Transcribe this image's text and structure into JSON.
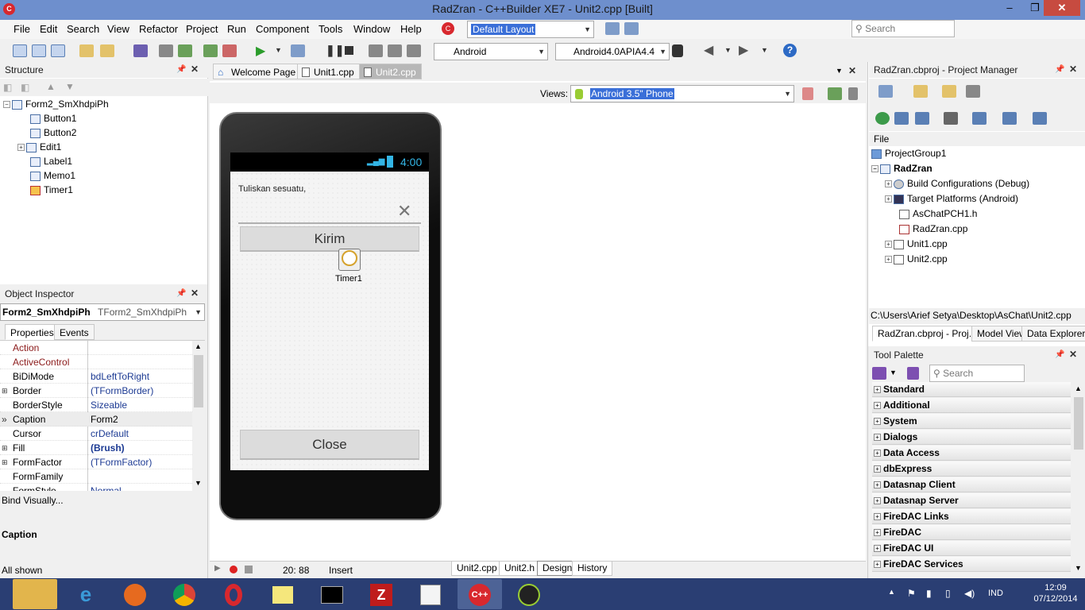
{
  "window": {
    "title": "RadZran - C++Builder XE7 - Unit2.cpp [Built]",
    "minimize": "–",
    "restore": "❐",
    "close": "✕"
  },
  "menu": [
    "File",
    "Edit",
    "Search",
    "View",
    "Refactor",
    "Project",
    "Run",
    "Component",
    "Tools",
    "Window",
    "Help"
  ],
  "toolbar": {
    "layout": "Default Layout",
    "search_placeholder": "Search",
    "platform": "Android",
    "device": "Android4.0APIA4.4"
  },
  "structure": {
    "title": "Structure",
    "root": "Form2_SmXhdpiPh",
    "items": [
      "Button1",
      "Button2",
      "Edit1",
      "Label1",
      "Memo1",
      "Timer1"
    ]
  },
  "editor_tabs": [
    "Welcome Page",
    "Unit1.cpp",
    "Unit2.cpp"
  ],
  "designer": {
    "views_label": "Views:",
    "views_value": "Android 3.5\" Phone",
    "status_time": "4:00",
    "label_text": "Tuliskan sesuatu,",
    "button1": "Kirim",
    "timer_label": "Timer1",
    "button2": "Close"
  },
  "object_inspector": {
    "title": "Object Inspector",
    "object_name": "Form2_SmXhdpiPh",
    "object_type": "TForm2_SmXhdpiPh",
    "tabs": [
      "Properties",
      "Events"
    ],
    "rows": [
      {
        "key": "Action",
        "value": "",
        "expand": false,
        "red": true
      },
      {
        "key": "ActiveControl",
        "value": "",
        "expand": false,
        "red": true
      },
      {
        "key": "BiDiMode",
        "value": "bdLeftToRight",
        "expand": false,
        "red": false
      },
      {
        "key": "Border",
        "value": "(TFormBorder)",
        "expand": true,
        "red": false
      },
      {
        "key": "BorderStyle",
        "value": "Sizeable",
        "expand": false,
        "red": false
      },
      {
        "key": "Caption",
        "value": "Form2",
        "expand": false,
        "red": false
      },
      {
        "key": "Cursor",
        "value": "crDefault",
        "expand": false,
        "red": false
      },
      {
        "key": "Fill",
        "value": "(Brush)",
        "expand": true,
        "red": false
      },
      {
        "key": "FormFactor",
        "value": "(TFormFactor)",
        "expand": true,
        "red": false
      },
      {
        "key": "FormFamily",
        "value": "",
        "expand": false,
        "red": false
      },
      {
        "key": "FormStyle",
        "value": "Normal",
        "expand": false,
        "red": false
      }
    ],
    "bind_visually": "Bind Visually...",
    "desc_title": "Caption",
    "status": "All shown"
  },
  "editor_status": {
    "position": "20: 88",
    "mode": "Insert",
    "tabs": [
      "Unit2.cpp",
      "Unit2.h",
      "Design",
      "History"
    ]
  },
  "project_manager": {
    "title": "RadZran.cbproj - Project Manager",
    "file_label": "File",
    "group": "ProjectGroup1",
    "project": "RadZran",
    "items": [
      "Build Configurations (Debug)",
      "Target Platforms (Android)",
      "AsChatPCH1.h",
      "RadZran.cpp",
      "Unit1.cpp",
      "Unit2.cpp"
    ],
    "path": "C:\\Users\\Arief Setya\\Desktop\\AsChat\\Unit2.cpp",
    "tabs": [
      "RadZran.cbproj - Proj...",
      "Model View",
      "Data Explorer"
    ]
  },
  "tool_palette": {
    "title": "Tool Palette",
    "search_placeholder": "Search",
    "categories": [
      "Standard",
      "Additional",
      "System",
      "Dialogs",
      "Data Access",
      "dbExpress",
      "Datasnap Client",
      "Datasnap Server",
      "FireDAC Links",
      "FireDAC",
      "FireDAC UI",
      "FireDAC Services"
    ]
  },
  "taskbar": {
    "lang": "IND",
    "time": "12:09",
    "date": "07/12/2014"
  }
}
